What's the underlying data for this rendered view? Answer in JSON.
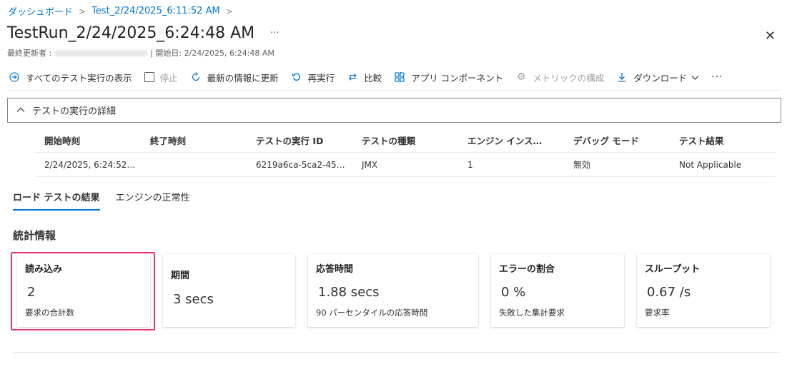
{
  "breadcrumb": {
    "items": [
      "ダッシュボード",
      "Test_2/24/2025_6:11:52 AM"
    ],
    "separator": ">"
  },
  "header": {
    "title": "TestRun_2/24/2025_6:24:48 AM",
    "more": "···",
    "close": "✕",
    "last_updated_label": "最終更新者 :",
    "start_label": "| 開始日: 2/24/2025, 6:24:48 AM"
  },
  "toolbar": {
    "view_all": "すべてのテスト実行の表示",
    "stop": "停止",
    "refresh": "最新の情報に更新",
    "rerun": "再実行",
    "compare": "比較",
    "app_components": "アプリ コンポーネント",
    "metrics_config": "メトリックの構成",
    "download": "ダウンロード",
    "more": "···"
  },
  "details": {
    "header": "テストの実行の詳細",
    "columns": [
      "開始時刻",
      "終了時刻",
      "テストの実行 ID",
      "テストの種類",
      "エンジン インス…",
      "デバッグ モード",
      "テスト結果"
    ],
    "row": [
      "2/24/2025, 6:24:52…",
      "",
      "6219a6ca-5ca2-45…",
      "JMX",
      "1",
      "無効",
      "Not Applicable"
    ]
  },
  "tabs": [
    "ロード テストの結果",
    "エンジンの正常性"
  ],
  "stats": {
    "title": "統計情報",
    "cards": [
      {
        "title": "読み込み",
        "value": "2",
        "desc": "要求の合計数"
      },
      {
        "title": "期間",
        "value": "3 secs",
        "desc": ""
      },
      {
        "title": "応答時間",
        "value": "1.88 secs",
        "desc": "90 パーセンタイルの応答時間"
      },
      {
        "title": "エラーの割合",
        "value": "0 %",
        "desc": "失敗した集計要求"
      },
      {
        "title": "スループット",
        "value": "0.67 /s",
        "desc": "要求率"
      }
    ]
  },
  "colors": {
    "accent": "#0078d4",
    "highlight": "#e8336e"
  }
}
